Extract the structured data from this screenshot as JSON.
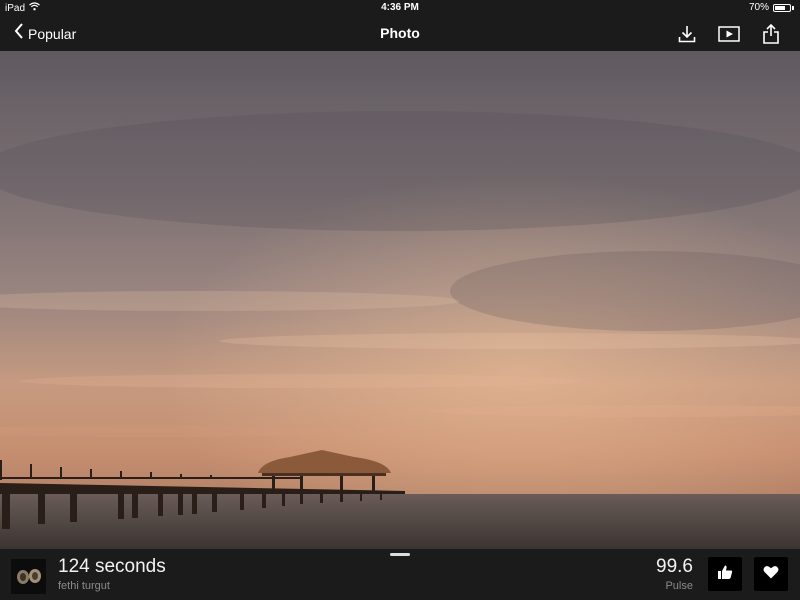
{
  "status_bar": {
    "device": "iPad",
    "time": "4:36 PM",
    "battery": "70%",
    "battery_level": 0.7
  },
  "nav": {
    "back_label": "Popular",
    "title": "Photo",
    "icons": [
      "download-icon",
      "slideshow-icon",
      "share-icon"
    ]
  },
  "photo_info": {
    "title": "124 seconds",
    "author": "fethi turgut",
    "pulse_value": "99.6",
    "pulse_label": "Pulse"
  },
  "colors": {
    "bar_background": "#1b1b1b",
    "secondary_text": "#8a8a8a"
  }
}
